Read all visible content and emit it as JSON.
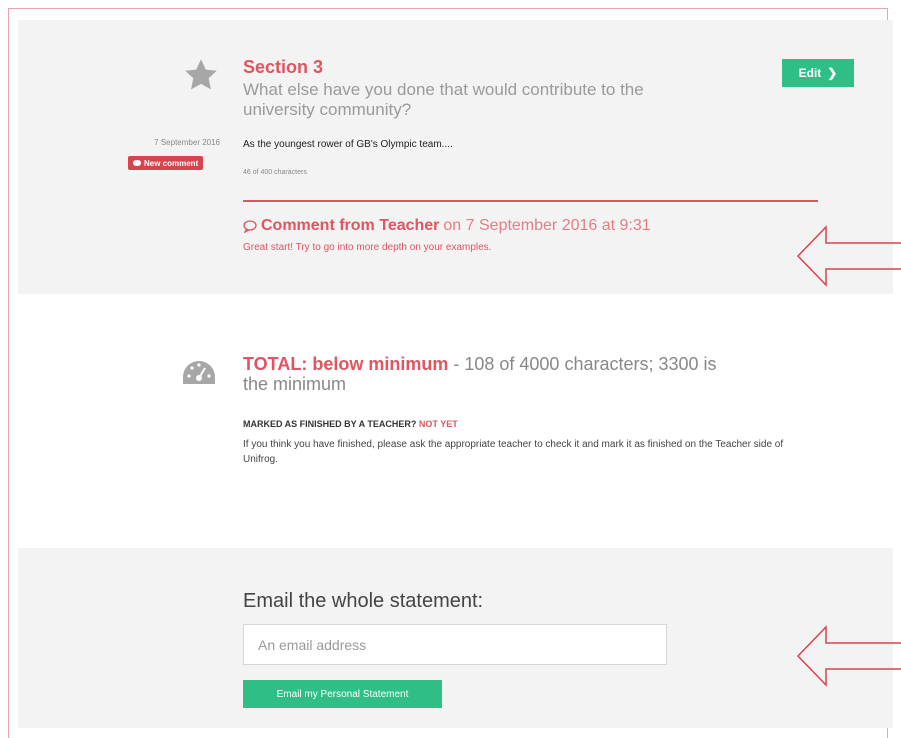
{
  "section": {
    "title": "Section 3",
    "question": "What else have you done that would contribute to the university community?",
    "edit_label": "Edit",
    "date": "7 September 2016",
    "badge_label": "New comment",
    "answer": "As the youngest rower of GB's Olympic team....",
    "char_count": "46 of 400 characters"
  },
  "comment": {
    "from": "Comment from Teacher",
    "when": "on 7 September 2016 at 9:31",
    "body": "Great start! Try to go into more depth on your examples."
  },
  "total": {
    "lead": "TOTAL: below minimum",
    "detail": "- 108 of 4000 characters; 3300 is the minimum",
    "marked_label": "MARKED AS FINISHED BY A TEACHER?",
    "marked_value": "NOT YET",
    "instructions": "If you think you have finished, please ask the appropriate teacher to check it and mark it as finished on the Teacher side of Unifrog."
  },
  "email": {
    "title": "Email the whole statement:",
    "placeholder": "An email address",
    "button_label": "Email my Personal Statement"
  },
  "colors": {
    "accent_red": "#e0555f",
    "accent_green": "#2fbf86",
    "panel_grey": "#f3f3f3"
  },
  "icons": [
    "star-icon",
    "chevron-right-icon",
    "comment-icon",
    "gauge-icon",
    "arrow-left-icon"
  ]
}
